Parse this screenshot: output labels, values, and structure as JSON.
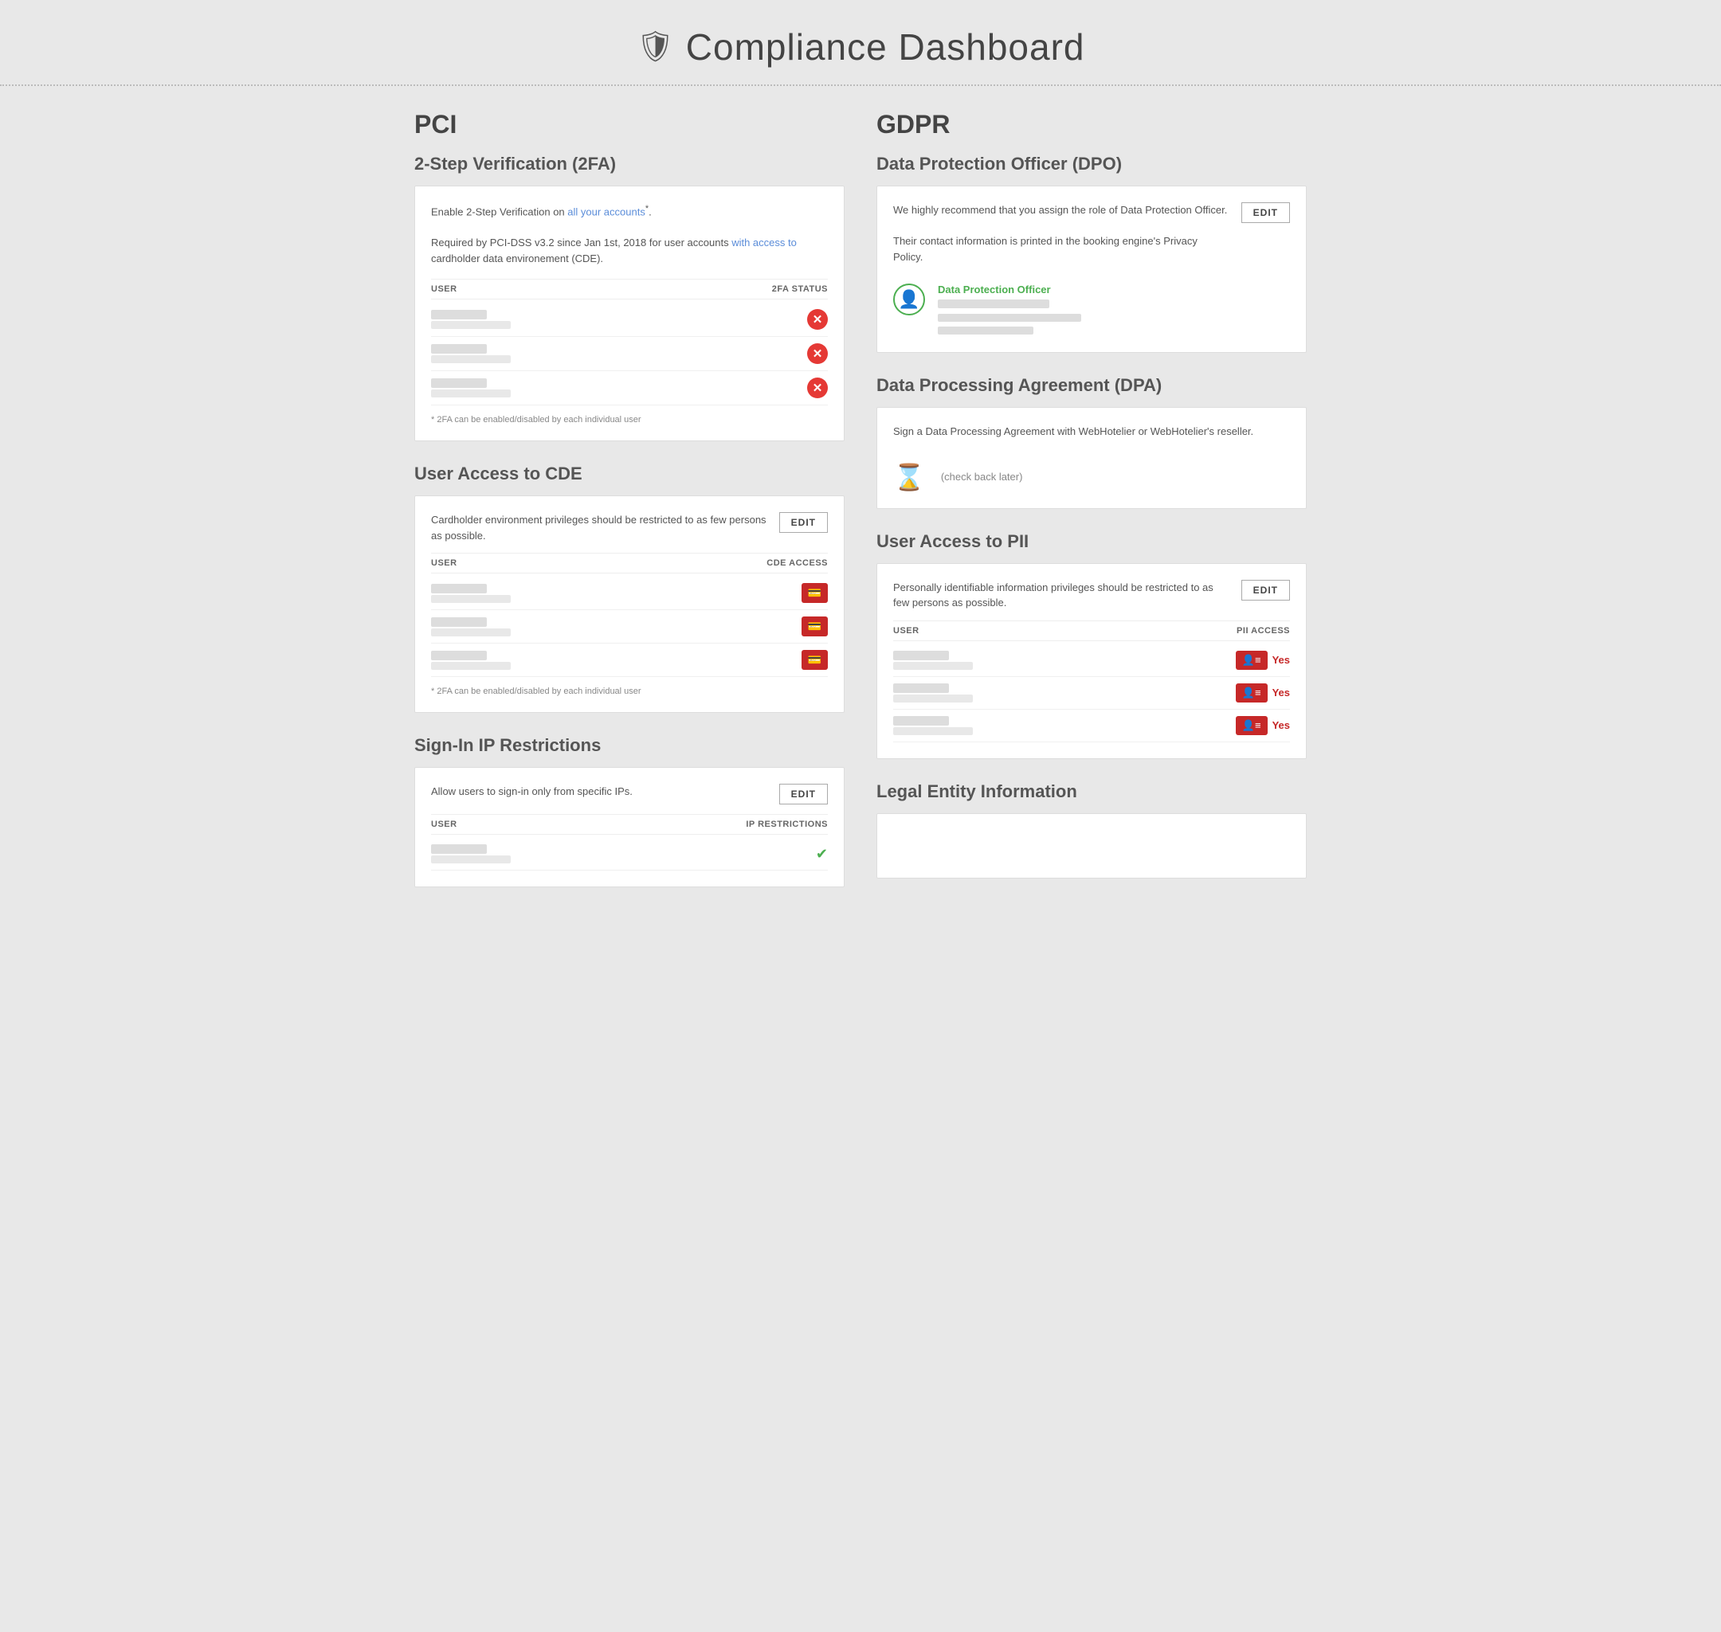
{
  "header": {
    "title": "Compliance Dashboard",
    "icon": "shield"
  },
  "pci": {
    "column_title": "PCI",
    "two_fa": {
      "section_title": "2-Step Verification (2FA)",
      "card_desc_line1": "Enable 2-Step Verification on ",
      "card_desc_highlight": "all your accounts",
      "card_desc_line1_end": "*.",
      "card_desc_line2_start": "Required by PCI-DSS v3.2 since Jan 1st, 2018 for user accounts ",
      "card_desc_highlight2": "with access to",
      "card_desc_line2_end": " cardholder data environement (CDE).",
      "col_user": "USER",
      "col_status": "2FA STATUS",
      "footnote": "* 2FA can be enabled/disabled by each individual user",
      "users": [
        {
          "name_blur": true,
          "sub_blur": true
        },
        {
          "name_blur": true,
          "sub_blur": true
        },
        {
          "name_blur": true,
          "sub_blur": true
        }
      ]
    },
    "user_access_cde": {
      "section_title": "User Access to CDE",
      "card_desc": "Cardholder environment privileges should be restricted to as few persons as possible.",
      "edit_label": "EDIT",
      "col_user": "USER",
      "col_access": "CDE ACCESS",
      "footnote": "* 2FA can be enabled/disabled by each individual user",
      "users": [
        {
          "name_blur": true,
          "sub_blur": true
        },
        {
          "name_blur": true,
          "sub_blur": true
        },
        {
          "name_blur": true,
          "sub_blur": true
        }
      ]
    },
    "sign_in_ip": {
      "section_title": "Sign-In IP Restrictions",
      "card_desc": "Allow users to sign-in only from specific IPs.",
      "edit_label": "EDIT",
      "col_user": "USER",
      "col_restrictions": "IP RESTRICTIONS"
    }
  },
  "gdpr": {
    "column_title": "GDPR",
    "dpo": {
      "section_title": "Data Protection Officer (DPO)",
      "card_desc1": "We highly recommend that you assign the role of Data Protection Officer.",
      "card_desc2": "Their contact information is printed in the booking engine's Privacy Policy.",
      "edit_label": "EDIT",
      "role_label": "Data Protection Officer",
      "person_name_blur": true,
      "person_email_blur": true,
      "person_loc_blur": true
    },
    "dpa": {
      "section_title": "Data Processing Agreement (DPA)",
      "card_desc": "Sign a Data Processing Agreement with WebHotelier or WebHotelier's reseller.",
      "check_back": "(check back later)"
    },
    "user_access_pii": {
      "section_title": "User Access to PII",
      "card_desc": "Personally identifiable information privileges should be restricted to as few persons as possible.",
      "edit_label": "EDIT",
      "col_user": "USER",
      "col_access": "PII ACCESS",
      "yes_label": "Yes",
      "users": [
        {
          "name_blur": true,
          "sub_blur": true
        },
        {
          "name_blur": true,
          "sub_blur": true
        },
        {
          "name_blur": true,
          "sub_blur": true
        }
      ]
    },
    "legal_entity": {
      "section_title": "Legal Entity Information"
    }
  }
}
